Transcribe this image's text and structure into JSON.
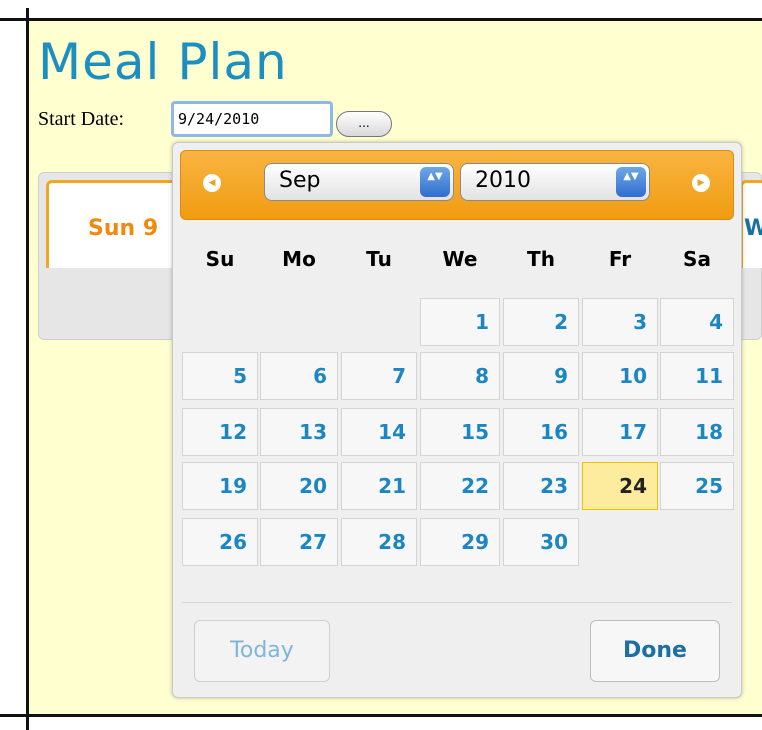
{
  "page": {
    "title": "Meal Plan",
    "start_date_label": "Start Date:",
    "start_date_value": "9/24/2010",
    "picker_button_label": "..."
  },
  "tabs": {
    "first_label": "Sun 9",
    "second_label_fragment": "We"
  },
  "datepicker": {
    "prev_icon": "◀",
    "next_icon": "▶",
    "month_selected": "Sep",
    "year_selected": "2010",
    "select_arrow_icon": "▲▼",
    "weekdays": [
      "Su",
      "Mo",
      "Tu",
      "We",
      "Th",
      "Fr",
      "Sa"
    ],
    "weeks": [
      [
        "",
        "",
        "",
        "1",
        "2",
        "3",
        "4"
      ],
      [
        "5",
        "6",
        "7",
        "8",
        "9",
        "10",
        "11"
      ],
      [
        "12",
        "13",
        "14",
        "15",
        "16",
        "17",
        "18"
      ],
      [
        "19",
        "20",
        "21",
        "22",
        "23",
        "24",
        "25"
      ],
      [
        "26",
        "27",
        "28",
        "29",
        "30",
        "",
        ""
      ]
    ],
    "selected_day": "24",
    "today_label": "Today",
    "done_label": "Done"
  },
  "colors": {
    "page_background": "#ffffd0",
    "title": "#1b8fbf",
    "header_orange": "#f0a020",
    "day_text": "#1b86c2",
    "selected_day_bg": "#fdec9e"
  }
}
